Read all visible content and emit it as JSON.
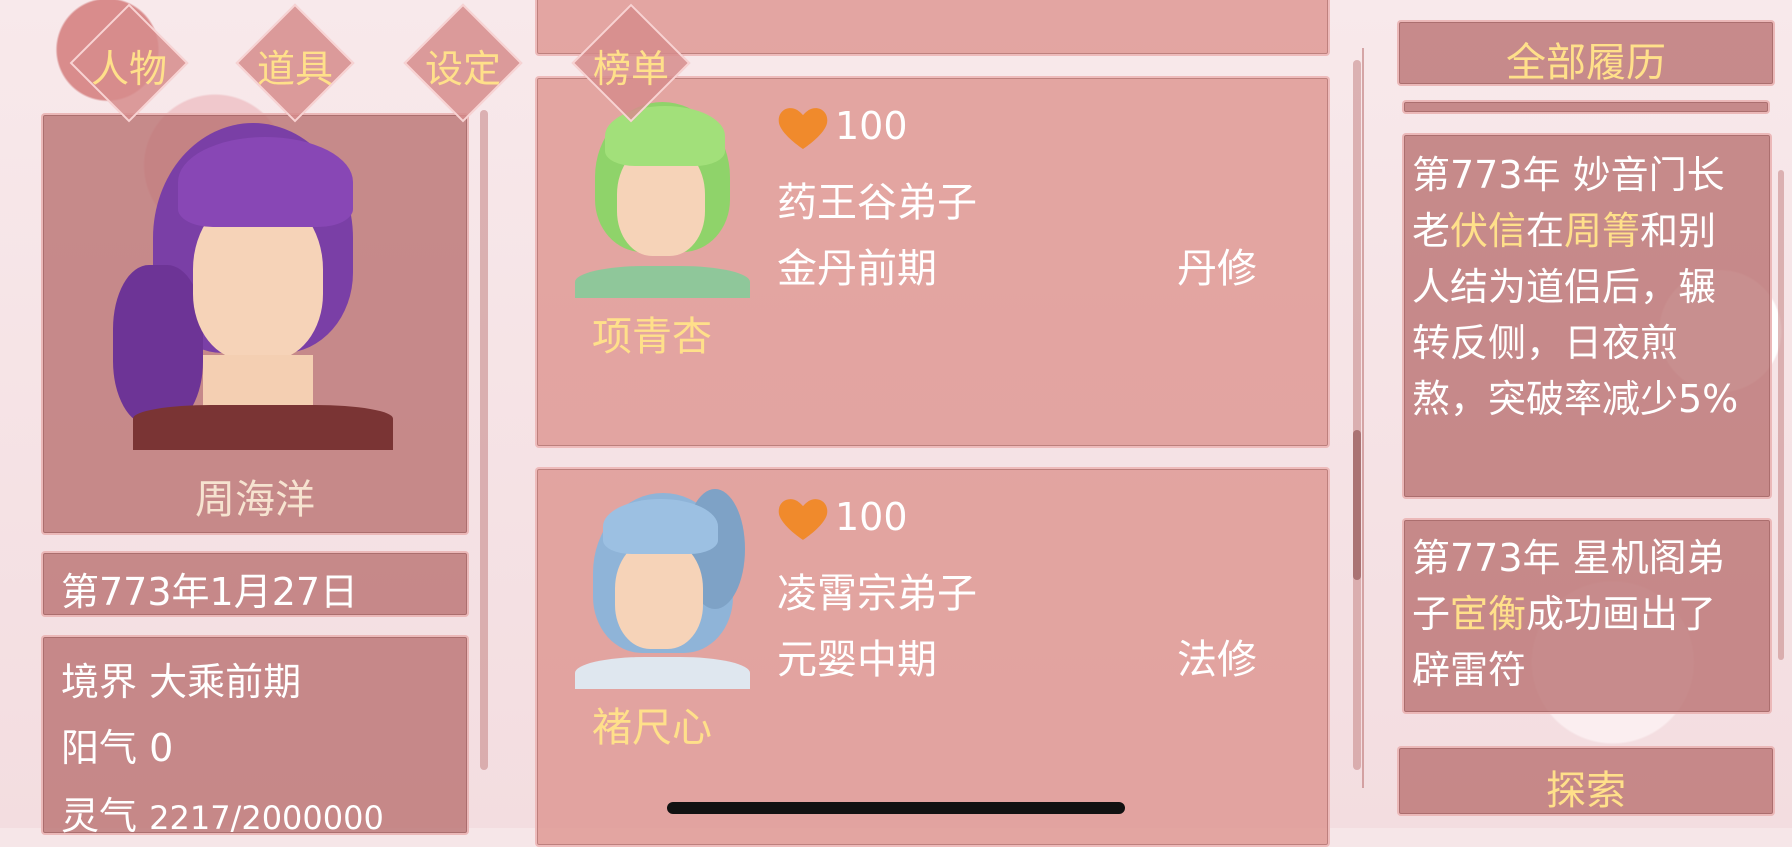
{
  "tabs": [
    "人物",
    "道具",
    "设定",
    "榜单"
  ],
  "player": {
    "name": "周海洋",
    "date": "第773年1月27日",
    "realm_label": "境界",
    "realm_value": "大乘前期",
    "yang_label": "阳气",
    "yang_value": "0",
    "spirit_label": "灵气",
    "spirit_value": "2217/2000000"
  },
  "companions": [
    {
      "affection": "100",
      "sect": "药王谷弟子",
      "stage": "金丹前期",
      "path": "丹修",
      "name": "项青杏",
      "hair_color": "#8fd36a"
    },
    {
      "affection": "100",
      "sect": "凌霄宗弟子",
      "stage": "元婴中期",
      "path": "法修",
      "name": "褚尺心",
      "hair_color": "#8fb4d8"
    }
  ],
  "history": {
    "header": "全部履历",
    "entries": [
      [
        {
          "t": "第773年 妙音门长老",
          "hl": false
        },
        {
          "t": "伏信",
          "hl": true
        },
        {
          "t": "在",
          "hl": false
        },
        {
          "t": "周箐",
          "hl": true
        },
        {
          "t": "和别人结为道侣后，辗转反侧，日夜煎熬，突破率减少5%",
          "hl": false
        }
      ],
      [
        {
          "t": "第773年 星机阁弟子",
          "hl": false
        },
        {
          "t": "宦衡",
          "hl": true
        },
        {
          "t": "成功画出了辟雷符",
          "hl": false
        }
      ]
    ],
    "explore": "探索"
  },
  "colors": {
    "gold": "#ffe08a",
    "heart": "#f08a2c",
    "panel": "#b87070"
  }
}
